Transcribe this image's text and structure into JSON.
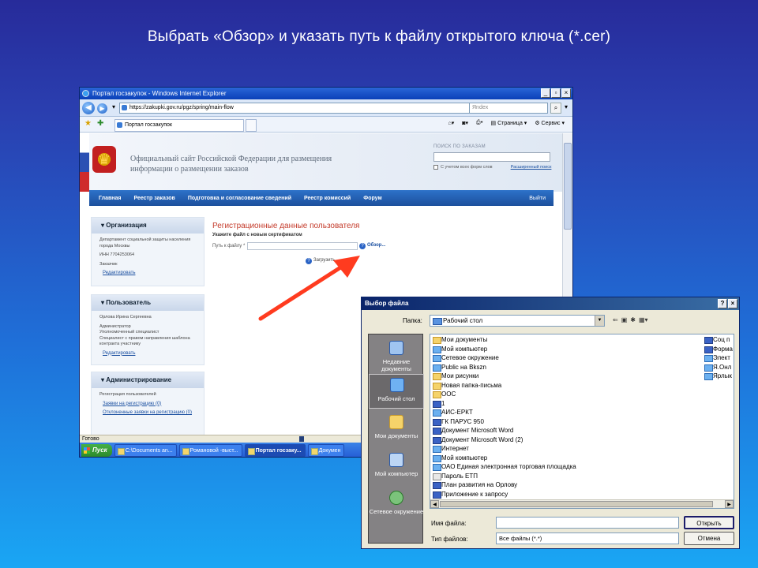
{
  "slide": {
    "title": "Выбрать «Обзор» и указать путь к файлу открытого ключа (*.cer)"
  },
  "ie": {
    "window_title": "Портал госзакупок - Windows Internet Explorer",
    "url": "https://zakupki.gov.ru/pgz/spring/main-flow",
    "search_placeholder": "Яndex",
    "tab_title": "Портал госзакупок",
    "tools": [
      "Страница",
      "Сервис"
    ],
    "status_text": "Готово"
  },
  "site": {
    "name_line1": "Официальный сайт Российской Федерации для размещения",
    "name_line2": "информации о размещении заказов",
    "search_label": "ПОИСК ПО ЗАКАЗАМ",
    "search_option": "С учетом всех форм слов",
    "advanced_search": "Расширенный поиск",
    "nav": [
      "Главная",
      "Реестр заказов",
      "Подготовка и согласование сведений",
      "Реестр комиссий",
      "Форум"
    ],
    "nav_exit": "Выйти"
  },
  "sidebar": {
    "org": {
      "title": "Организация",
      "lines": [
        "Департамент социальной защиты населения города Москвы",
        "ИНН 7704253064",
        "Заказчик"
      ],
      "link": "Редактировать"
    },
    "user": {
      "title": "Пользователь",
      "lines": [
        "Орлова Ирина Сергеевна",
        "Администратор",
        "Уполномоченный специалист",
        "Специалист с правом направления шаблона контракта участнику"
      ],
      "link": "Редактировать"
    },
    "admin": {
      "title": "Администрирование",
      "lines": [
        "Регистрация пользователей"
      ],
      "links": [
        "Заявки на регистрацию (0)",
        "Отклоненные заявки на регистрацию (0)"
      ]
    }
  },
  "main": {
    "title": "Регистрационные данные пользователя",
    "subtitle": "Укажите файл с новым сертификатом",
    "path_label": "Путь к файлу *",
    "browse": "Обзор...",
    "upload": "Загрузить"
  },
  "taskbar": {
    "start": "Пуск",
    "tasks": [
      "C:\\Documents an...",
      "Романовой -выст...",
      "Портал госзаку...",
      "Докумен"
    ]
  },
  "dialog": {
    "title": "Выбор файла",
    "folder_label": "Папка:",
    "folder_value": "Рабочий стол",
    "places": [
      "Недавние документы",
      "Рабочий стол",
      "Мои документы",
      "Мой компьютер",
      "Сетевое окружение"
    ],
    "files": [
      {
        "name": "Мои документы",
        "kind": "folder"
      },
      {
        "name": "Мой компьютер",
        "kind": "sys"
      },
      {
        "name": "Сетевое окружение",
        "kind": "sys"
      },
      {
        "name": "Public на Bkszn",
        "kind": "sys"
      },
      {
        "name": "Мои рисунки",
        "kind": "folder"
      },
      {
        "name": "Новая папка-письма",
        "kind": "folder"
      },
      {
        "name": "ООС",
        "kind": "folder"
      },
      {
        "name": "1",
        "kind": "doc"
      },
      {
        "name": "АИС-ЕРКТ",
        "kind": "sys"
      },
      {
        "name": "ГК ПАРУС 950",
        "kind": "doc"
      },
      {
        "name": "Документ Microsoft Word",
        "kind": "doc"
      },
      {
        "name": "Документ Microsoft Word (2)",
        "kind": "doc"
      },
      {
        "name": "Интернет",
        "kind": "sys"
      },
      {
        "name": "Мой компьютер",
        "kind": "sys"
      },
      {
        "name": "ОАО Единая электронная торговая площадка",
        "kind": "sys"
      },
      {
        "name": "Пароль ЕТП",
        "kind": "pdf"
      },
      {
        "name": "План развития на Орлову",
        "kind": "doc"
      },
      {
        "name": "Приложение к запросу",
        "kind": "doc"
      }
    ],
    "files_col2": [
      {
        "name": "Соц п",
        "kind": "doc"
      },
      {
        "name": "Форма",
        "kind": "doc"
      },
      {
        "name": "Элект",
        "kind": "sys"
      },
      {
        "name": "Я.Онл",
        "kind": "sys"
      },
      {
        "name": "Ярлык",
        "kind": "sys"
      }
    ],
    "filename_label": "Имя файла:",
    "filename_value": "",
    "filetype_label": "Тип файлов:",
    "filetype_value": "Все файлы (*.*)",
    "open_button": "Открыть",
    "cancel_button": "Отмена"
  }
}
